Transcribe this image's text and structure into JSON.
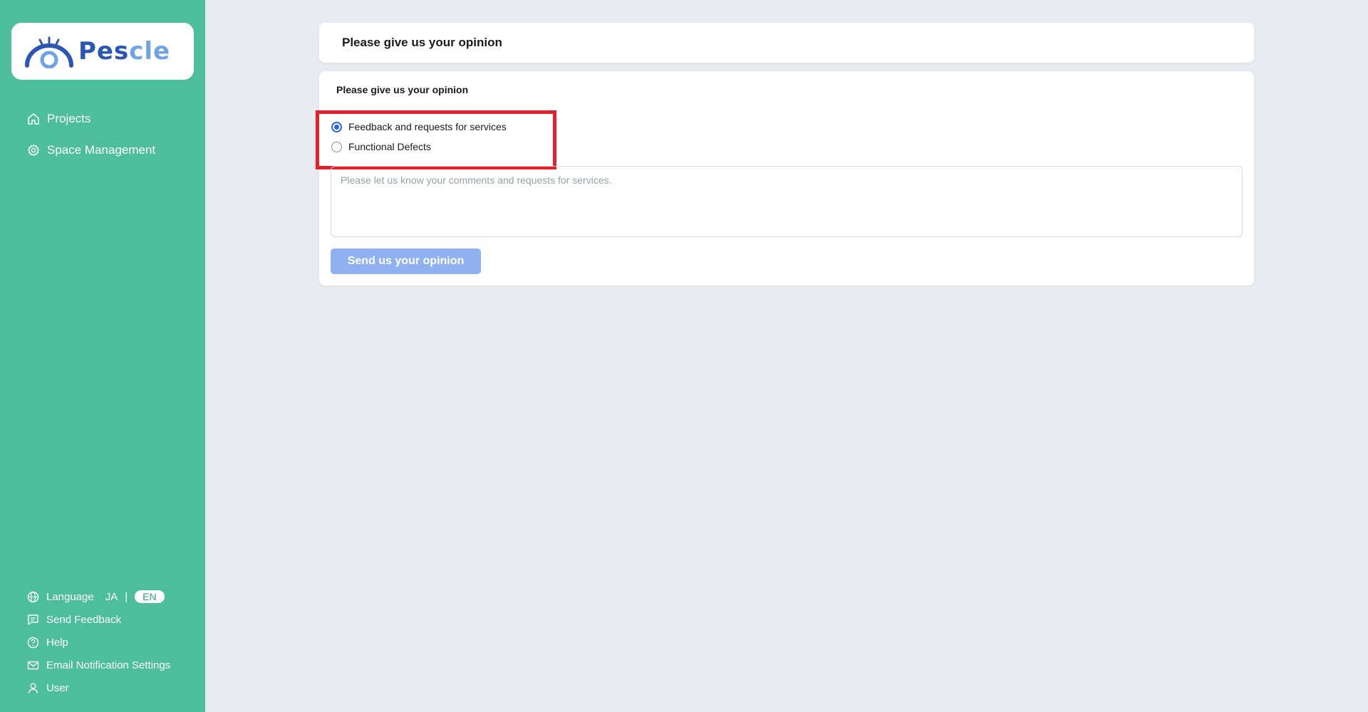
{
  "app": {
    "logo_text_dark": "Pes",
    "logo_text_light": "cle"
  },
  "sidebar": {
    "nav": [
      {
        "label": "Projects",
        "icon": "home-icon"
      },
      {
        "label": "Space Management",
        "icon": "gear-icon"
      }
    ],
    "bottom": {
      "language_label": "Language",
      "lang_ja": "JA",
      "lang_sep": "|",
      "lang_en": "EN",
      "send_feedback": "Send Feedback",
      "help": "Help",
      "email_settings": "Email Notification Settings",
      "user": "User"
    }
  },
  "page": {
    "header_title": "Please give us your opinion",
    "form_title": "Please give us your opinion",
    "options": [
      {
        "label": "Feedback and requests for services",
        "checked": true
      },
      {
        "label": "Functional Defects",
        "checked": false
      }
    ],
    "textarea_placeholder": "Please let us know your comments and requests for services.",
    "submit_label": "Send us your opinion"
  },
  "colors": {
    "sidebar": "#4cbe9a",
    "accent": "#2563eb",
    "submit_disabled": "#8fb1f2",
    "highlight": "#e5202a"
  }
}
